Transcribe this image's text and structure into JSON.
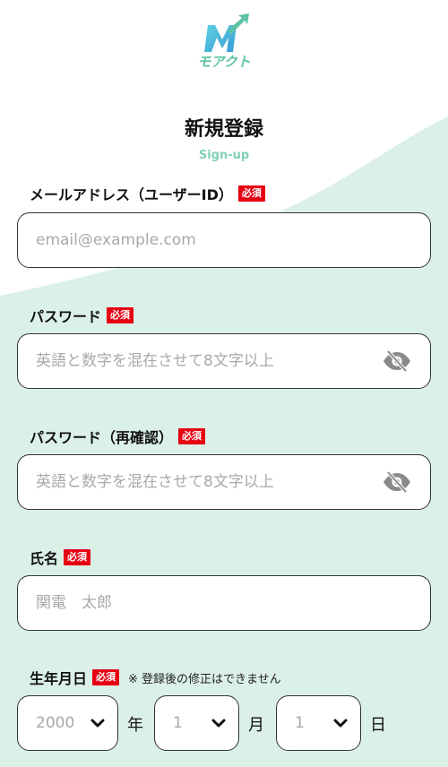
{
  "brand": {
    "name": "モアクト",
    "accent": "#5bc3a4",
    "bg_wave": "#dbf0e6"
  },
  "header": {
    "title": "新規登録",
    "subtitle": "Sign-up"
  },
  "required_badge": "必須",
  "fields": {
    "email": {
      "label": "メールアドレス（ユーザーID）",
      "placeholder": "email@example.com",
      "value": ""
    },
    "password": {
      "label": "パスワード",
      "placeholder": "英語と数字を混在させて8文字以上",
      "value": "",
      "icon": "eye-off-icon"
    },
    "password_confirm": {
      "label": "パスワード（再確認）",
      "placeholder": "英語と数字を混在させて8文字以上",
      "value": "",
      "icon": "eye-off-icon"
    },
    "name": {
      "label": "氏名",
      "placeholder": "関電　太郎",
      "value": ""
    }
  },
  "birthdate": {
    "label": "生年月日",
    "note": "※ 登録後の修正はできません",
    "year": {
      "value": "2000",
      "unit": "年"
    },
    "month": {
      "value": "1",
      "unit": "月"
    },
    "day": {
      "value": "1",
      "unit": "日"
    }
  }
}
